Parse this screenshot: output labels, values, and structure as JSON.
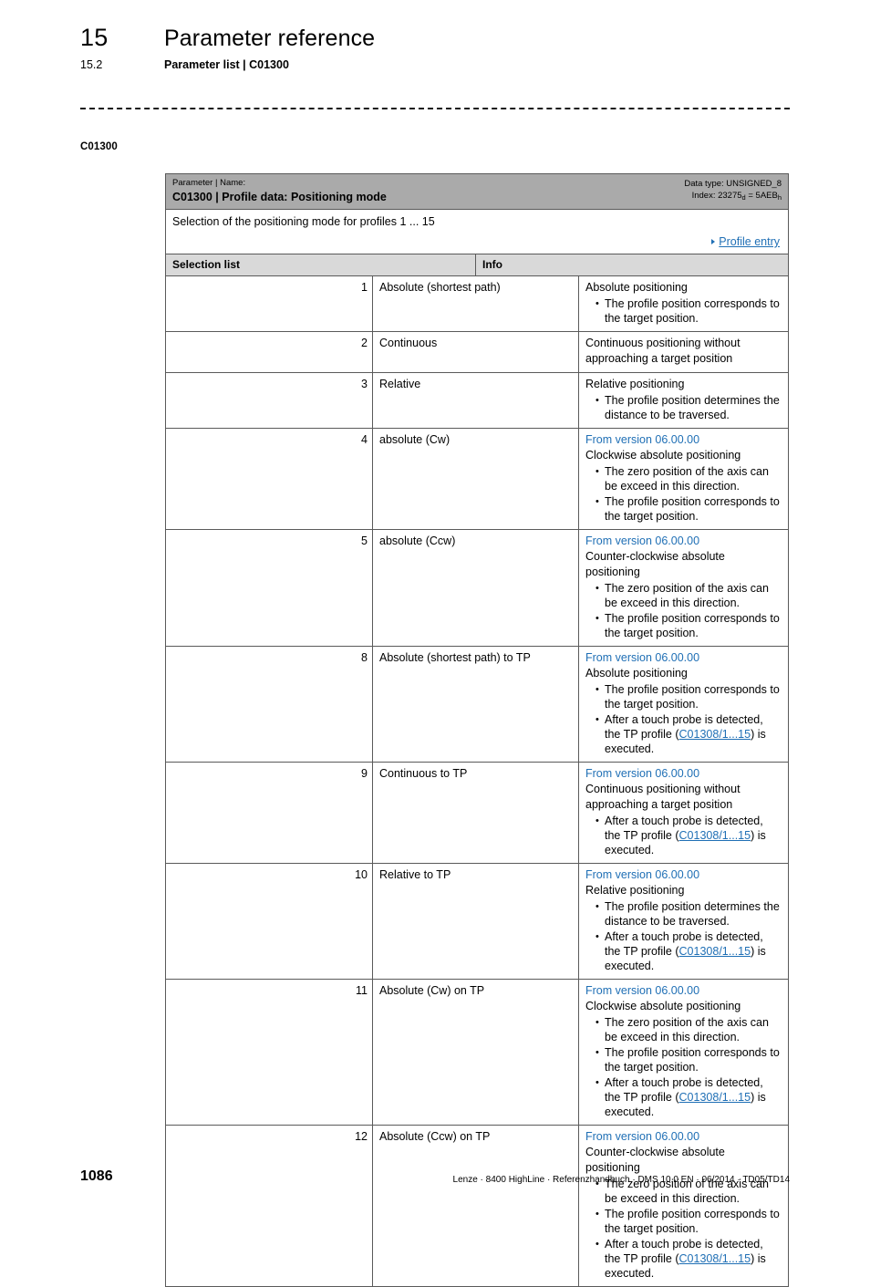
{
  "header": {
    "chapter_number": "15",
    "chapter_title": "Parameter reference",
    "section_number": "15.2",
    "section_title": "Parameter list | C01300"
  },
  "margin_label": "C01300",
  "parameter": {
    "caption": "Parameter | Name:",
    "title": "C01300 | Profile data: Positioning mode",
    "data_type": "Data type: UNSIGNED_8",
    "index_prefix": "Index: 23275",
    "index_sub_d": "d",
    "index_mid": " = 5AEB",
    "index_sub_h": "h",
    "description": "Selection of the positioning mode for profiles 1 ... 15",
    "link": "Profile entry"
  },
  "columns": {
    "selection_list": "Selection list",
    "info": "Info"
  },
  "version_note": "From version 06.00.00",
  "tp_link_text": "C01308/1...15",
  "rows": [
    {
      "index": "1",
      "name": "Absolute (shortest path)",
      "version": "",
      "lead": "Absolute positioning",
      "bullets": [
        {
          "pre": "The profile position corresponds to the target position.",
          "link": "",
          "post": ""
        }
      ]
    },
    {
      "index": "2",
      "name": "Continuous",
      "version": "",
      "lead": "Continuous positioning without approaching a target position",
      "bullets": []
    },
    {
      "index": "3",
      "name": "Relative",
      "version": "",
      "lead": "Relative positioning",
      "bullets": [
        {
          "pre": "The profile position determines the distance to be traversed.",
          "link": "",
          "post": ""
        }
      ]
    },
    {
      "index": "4",
      "name": "absolute (Cw)",
      "version": "From version 06.00.00",
      "lead": "Clockwise absolute positioning",
      "bullets": [
        {
          "pre": "The zero position of the axis can be exceed in this direction.",
          "link": "",
          "post": ""
        },
        {
          "pre": "The profile position corresponds to the target position.",
          "link": "",
          "post": ""
        }
      ]
    },
    {
      "index": "5",
      "name": "absolute (Ccw)",
      "version": "From version 06.00.00",
      "lead": "Counter-clockwise absolute positioning",
      "bullets": [
        {
          "pre": "The zero position of the axis can be exceed in this direction.",
          "link": "",
          "post": ""
        },
        {
          "pre": "The profile position corresponds to the target position.",
          "link": "",
          "post": ""
        }
      ]
    },
    {
      "index": "8",
      "name": "Absolute (shortest path) to TP",
      "version": "From version 06.00.00",
      "lead": "Absolute positioning",
      "bullets": [
        {
          "pre": "The profile position corresponds to the target position.",
          "link": "",
          "post": ""
        },
        {
          "pre": "After a touch probe is detected, the TP profile (",
          "link": "C01308/1...15",
          "post": ") is executed."
        }
      ]
    },
    {
      "index": "9",
      "name": "Continuous to TP",
      "version": "From version 06.00.00",
      "lead": "Continuous positioning without approaching a target position",
      "bullets": [
        {
          "pre": "After a touch probe is detected, the TP profile (",
          "link": "C01308/1...15",
          "post": ") is executed."
        }
      ]
    },
    {
      "index": "10",
      "name": "Relative to TP",
      "version": "From version 06.00.00",
      "lead": "Relative positioning",
      "bullets": [
        {
          "pre": "The profile position determines the distance to be traversed.",
          "link": "",
          "post": ""
        },
        {
          "pre": "After a touch probe is detected, the TP profile (",
          "link": "C01308/1...15",
          "post": ") is executed."
        }
      ]
    },
    {
      "index": "11",
      "name": "Absolute (Cw) on TP",
      "version": "From version 06.00.00",
      "lead": "Clockwise absolute positioning",
      "bullets": [
        {
          "pre": "The zero position of the axis can be exceed in this direction.",
          "link": "",
          "post": ""
        },
        {
          "pre": "The profile position corresponds to the target position.",
          "link": "",
          "post": ""
        },
        {
          "pre": "After a touch probe is detected, the TP profile (",
          "link": "C01308/1...15",
          "post": ") is executed."
        }
      ]
    },
    {
      "index": "12",
      "name": "Absolute (Ccw) on TP",
      "version": "From version 06.00.00",
      "lead": "Counter-clockwise absolute positioning",
      "bullets": [
        {
          "pre": "The zero position of the axis can be exceed in this direction.",
          "link": "",
          "post": ""
        },
        {
          "pre": "The profile position corresponds to the target position.",
          "link": "",
          "post": ""
        },
        {
          "pre": "After a touch probe is detected, the TP profile (",
          "link": "C01308/1...15",
          "post": ") is executed."
        }
      ]
    }
  ],
  "footer": {
    "page_number": "1086",
    "meta": "Lenze · 8400 HighLine · Referenzhandbuch · DMS 10.0 EN · 06/2014 · TD05/TD14"
  },
  "colors": {
    "link_blue": "#1f6fb5",
    "header_band": "#aaaaaa",
    "column_band": "#d9d9d9",
    "border": "#5a5a5a"
  }
}
